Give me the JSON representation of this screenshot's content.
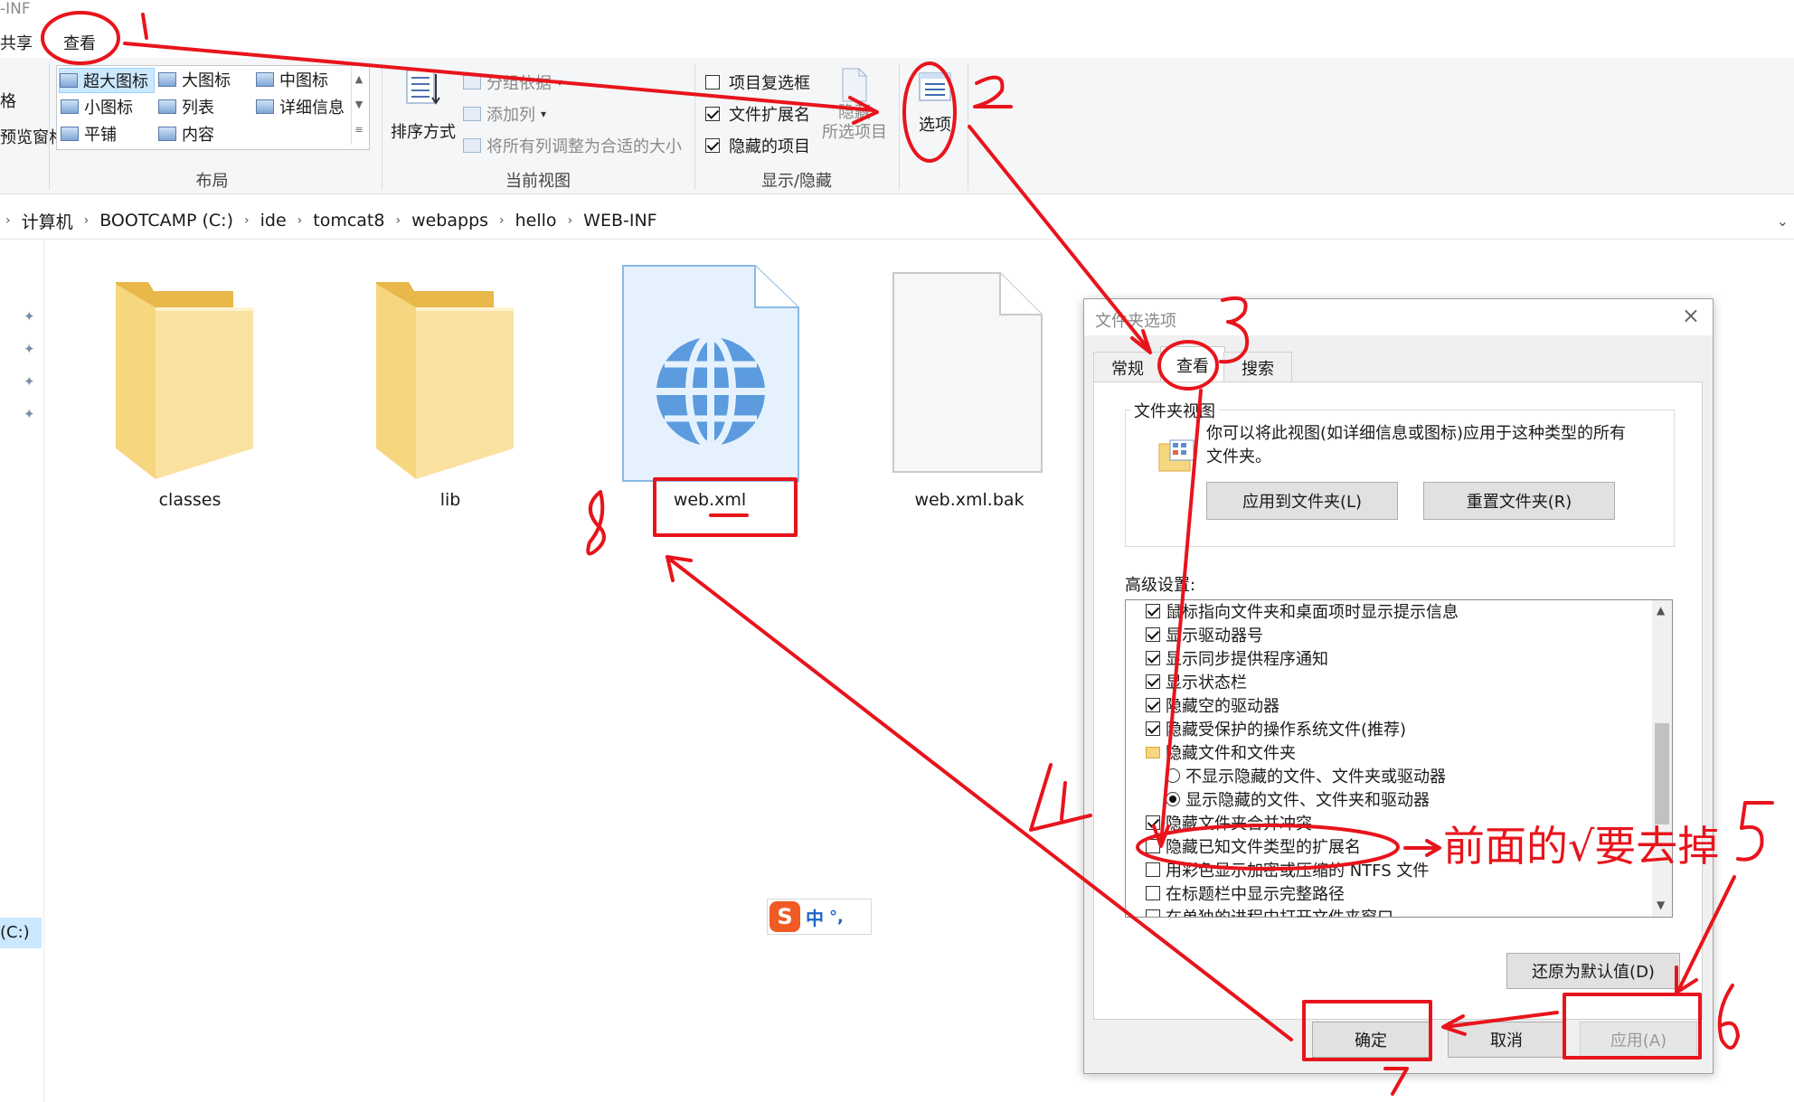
{
  "window_title_fragment": "-INF",
  "ribbon_tabs": {
    "share": "共享",
    "view": "查看"
  },
  "layout_group": {
    "left_fragments": [
      "格",
      "预览窗格"
    ],
    "items": [
      "超大图标",
      "大图标",
      "中图标",
      "小图标",
      "列表",
      "详细信息",
      "平铺",
      "内容"
    ],
    "label": "布局"
  },
  "current_view_group": {
    "sort_label": "排序方式",
    "group_by": "分组依据",
    "add_column": "添加列",
    "fit_columns": "将所有列调整为合适的大小",
    "label": "当前视图"
  },
  "show_hide_group": {
    "item_checkboxes": "项目复选框",
    "file_extensions": "文件扩展名",
    "hidden_items": "隐藏的项目",
    "hide_selected_line1": "隐藏",
    "hide_selected_line2": "所选项目",
    "label": "显示/隐藏"
  },
  "options_button": "选项",
  "breadcrumb": [
    "计算机",
    "BOOTCAMP (C:)",
    "ide",
    "tomcat8",
    "webapps",
    "hello",
    "WEB-INF"
  ],
  "nav_drive_fragment": "(C:)",
  "files": [
    {
      "name": "classes",
      "type": "folder"
    },
    {
      "name": "lib",
      "type": "folder"
    },
    {
      "name": "web.xml",
      "type": "xml",
      "selected": true
    },
    {
      "name": "web.xml.bak",
      "type": "blank"
    }
  ],
  "ime": {
    "logo": "S",
    "mode": "中",
    "punct": "°,"
  },
  "dialog": {
    "title": "文件夹选项",
    "tabs": [
      "常规",
      "查看",
      "搜索"
    ],
    "folder_view_legend": "文件夹视图",
    "folder_view_text": "你可以将此视图(如详细信息或图标)应用于这种类型的所有文件夹。",
    "apply_to_folders": "应用到文件夹(L)",
    "reset_folders": "重置文件夹(R)",
    "advanced_label": "高级设置:",
    "advanced_items": [
      {
        "type": "check",
        "checked": true,
        "label": "鼠标指向文件夹和桌面项时显示提示信息"
      },
      {
        "type": "check",
        "checked": true,
        "label": "显示驱动器号"
      },
      {
        "type": "check",
        "checked": true,
        "label": "显示同步提供程序通知"
      },
      {
        "type": "check",
        "checked": true,
        "label": "显示状态栏"
      },
      {
        "type": "check",
        "checked": true,
        "label": "隐藏空的驱动器"
      },
      {
        "type": "check",
        "checked": true,
        "label": "隐藏受保护的操作系统文件(推荐)"
      },
      {
        "type": "folder",
        "label": "隐藏文件和文件夹"
      },
      {
        "type": "radio",
        "checked": false,
        "label": "不显示隐藏的文件、文件夹或驱动器"
      },
      {
        "type": "radio",
        "checked": true,
        "label": "显示隐藏的文件、文件夹和驱动器"
      },
      {
        "type": "check",
        "checked": true,
        "label": "隐藏文件夹合并冲突"
      },
      {
        "type": "check",
        "checked": false,
        "label": "隐藏已知文件类型的扩展名"
      },
      {
        "type": "check",
        "checked": false,
        "label": "用彩色显示加密或压缩的 NTFS 文件"
      },
      {
        "type": "check",
        "checked": false,
        "label": "在标题栏中显示完整路径"
      },
      {
        "type": "check",
        "checked": false,
        "label": "在单独的进程中打开文件夹窗口"
      }
    ],
    "restore_defaults": "还原为默认值(D)",
    "ok": "确定",
    "cancel": "取消",
    "apply": "应用(A)"
  },
  "annotations": {
    "note": "前面的√要去掉",
    "color": "#e8141c"
  }
}
